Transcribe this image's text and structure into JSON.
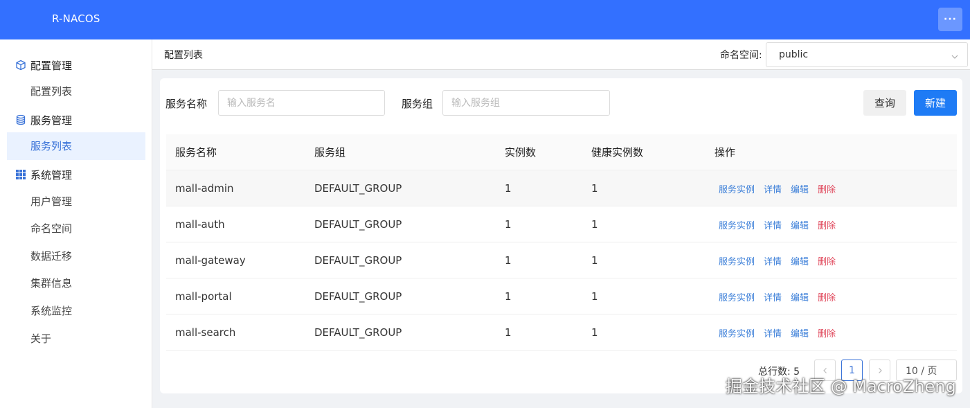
{
  "app": {
    "title": "R-NACOS"
  },
  "topbar": {
    "more_icon": "more-horizontal-icon",
    "more_glyph": "···"
  },
  "sidebar": {
    "groups": [
      {
        "label": "配置管理",
        "icon": "cube-icon",
        "items": [
          {
            "label": "配置列表"
          }
        ]
      },
      {
        "label": "服务管理",
        "icon": "database-icon",
        "items": [
          {
            "label": "服务列表",
            "active": true
          }
        ]
      },
      {
        "label": "系统管理",
        "icon": "grid-icon",
        "items": [
          {
            "label": "用户管理"
          },
          {
            "label": "命名空间"
          },
          {
            "label": "数据迁移"
          },
          {
            "label": "集群信息"
          },
          {
            "label": "系统监控"
          },
          {
            "label": "关于"
          }
        ]
      }
    ]
  },
  "header": {
    "breadcrumb": "配置列表",
    "namespace_label": "命名空间:",
    "namespace_value": "public"
  },
  "filters": {
    "service_name_label": "服务名称",
    "service_name_placeholder": "输入服务名",
    "service_group_label": "服务组",
    "service_group_placeholder": "输入服务组",
    "query_label": "查询",
    "new_label": "新建"
  },
  "table": {
    "columns": [
      "服务名称",
      "服务组",
      "实例数",
      "健康实例数",
      "操作"
    ],
    "rows": [
      {
        "name": "mall-admin",
        "group": "DEFAULT_GROUP",
        "instances": "1",
        "healthy": "1"
      },
      {
        "name": "mall-auth",
        "group": "DEFAULT_GROUP",
        "instances": "1",
        "healthy": "1"
      },
      {
        "name": "mall-gateway",
        "group": "DEFAULT_GROUP",
        "instances": "1",
        "healthy": "1"
      },
      {
        "name": "mall-portal",
        "group": "DEFAULT_GROUP",
        "instances": "1",
        "healthy": "1"
      },
      {
        "name": "mall-search",
        "group": "DEFAULT_GROUP",
        "instances": "1",
        "healthy": "1"
      }
    ],
    "actions": {
      "instances": "服务实例",
      "detail": "详情",
      "edit": "编辑",
      "delete": "删除"
    }
  },
  "pagination": {
    "total_label": "总行数: 5",
    "current_page": "1",
    "page_size": "10 / 页"
  },
  "watermark": "掘金技术社区 @ MacroZheng",
  "colors": {
    "brand": "#3370ff",
    "link": "#3a7ed8",
    "danger": "#e0475b",
    "primary": "#1e7bf5"
  }
}
